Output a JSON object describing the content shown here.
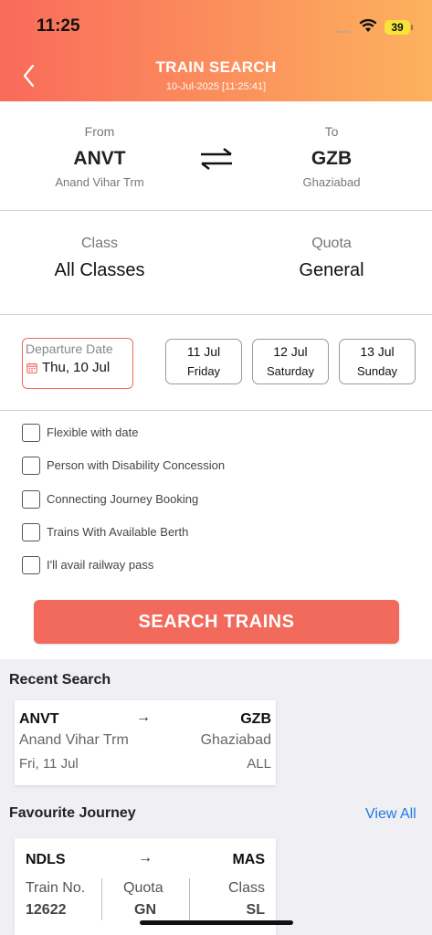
{
  "status_bar": {
    "time": "11:25",
    "signal_dots": "••••",
    "battery": "39"
  },
  "header": {
    "title": "TRAIN SEARCH",
    "subtitle": "10-Jul-2025 [11:25:41]"
  },
  "route": {
    "from_label": "From",
    "from_code": "ANVT",
    "from_name": "Anand Vihar Trm",
    "to_label": "To",
    "to_code": "GZB",
    "to_name": "Ghaziabad"
  },
  "class_quota": {
    "class_label": "Class",
    "class_value": "All Classes",
    "quota_label": "Quota",
    "quota_value": "General"
  },
  "departure": {
    "label": "Departure Date",
    "value": "Thu, 10 Jul"
  },
  "date_chips": [
    {
      "date": "11 Jul",
      "day": "Friday"
    },
    {
      "date": "12 Jul",
      "day": "Saturday"
    },
    {
      "date": "13 Jul",
      "day": "Sunday"
    }
  ],
  "options": [
    "Flexible with date",
    "Person with Disability Concession",
    "Connecting Journey Booking",
    "Trains With Available Berth",
    "I'll avail railway pass"
  ],
  "search_button": "SEARCH TRAINS",
  "recent": {
    "title": "Recent Search",
    "from_code": "ANVT",
    "to_code": "GZB",
    "arrow": "→",
    "from_name": "Anand Vihar Trm",
    "to_name": "Ghaziabad",
    "date": "Fri, 11 Jul",
    "class": "ALL"
  },
  "favourite": {
    "title": "Favourite Journey",
    "view_all": "View All",
    "from_code": "NDLS",
    "to_code": "MAS",
    "arrow": "→",
    "train_no_label": "Train No.",
    "train_no": "12622",
    "quota_label": "Quota",
    "quota": "GN",
    "class_label": "Class",
    "class": "SL"
  },
  "colors": {
    "accent": "#f26a5c",
    "header_start": "#f96a5b",
    "header_end": "#fcb25e",
    "link": "#1f7ae0"
  }
}
